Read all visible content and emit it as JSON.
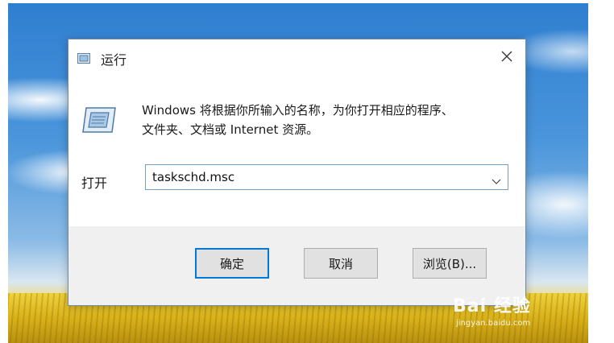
{
  "window": {
    "title": "运行",
    "description_line1": "Windows 将根据你所输入的名称，为你打开相应的程序、",
    "description_line2": "文件夹、文档或 Internet 资源。"
  },
  "open": {
    "label": "打开",
    "value": "taskschd.msc"
  },
  "buttons": {
    "ok": "确定",
    "cancel": "取消",
    "browse": "浏览(B)..."
  },
  "watermark": {
    "logo": "Bai 经验",
    "domain": "jingyan.baidu.com"
  },
  "colors": {
    "accent": "#0078d7",
    "dialog_footer": "#f0f0f0"
  },
  "icons": {
    "title": "run-icon",
    "main": "run-icon",
    "close": "close-icon",
    "dropdown": "chevron-down-icon"
  }
}
